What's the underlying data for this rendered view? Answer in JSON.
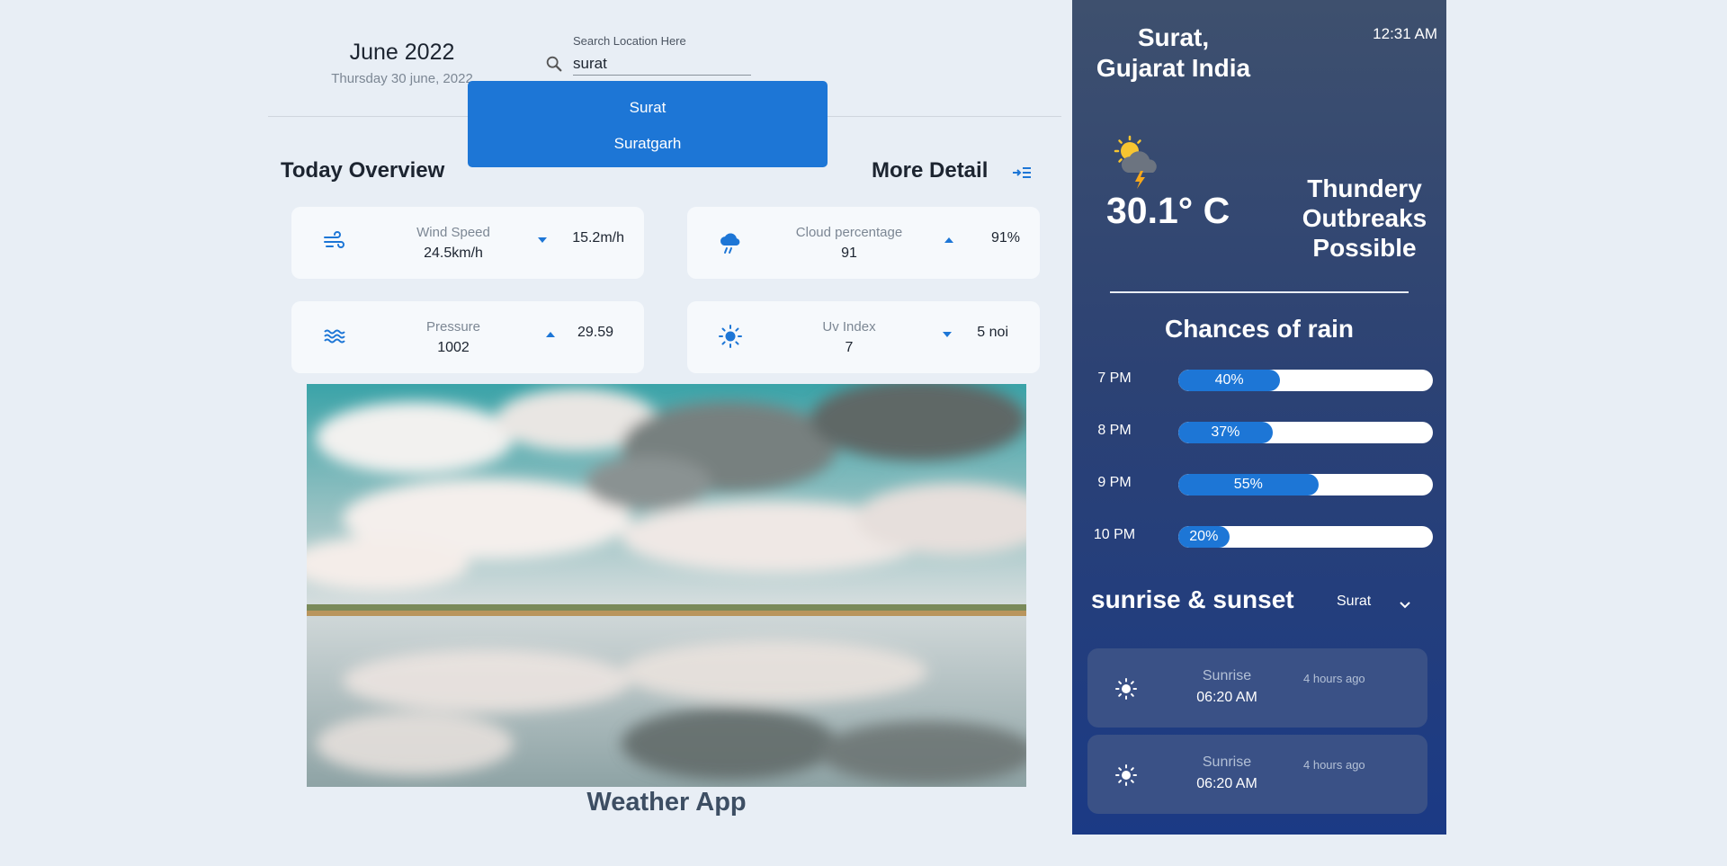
{
  "header": {
    "month": "June 2022",
    "day": "Thursday 30 june, 2022",
    "search_label": "Search Location Here",
    "search_value": "surat"
  },
  "search_results": [
    "Surat",
    "Suratgarh"
  ],
  "overview": {
    "title": "Today Overview",
    "more_detail": "More Detail",
    "cards": [
      {
        "label": "Wind Speed",
        "value": "24.5km/h",
        "trend": "down",
        "change": "15.2m/h",
        "icon": "wind-icon"
      },
      {
        "label": "Cloud percentage",
        "value": "91",
        "trend": "up",
        "change": "91%",
        "icon": "cloud-rain-icon"
      },
      {
        "label": "Pressure",
        "value": "1002",
        "trend": "up",
        "change": "29.59",
        "icon": "waves-icon"
      },
      {
        "label": "Uv Index",
        "value": "7",
        "trend": "down",
        "change": "5 noi",
        "icon": "sun-icon"
      }
    ]
  },
  "app_title": "Weather App",
  "panel": {
    "location": "Surat, Gujarat India",
    "time": "12:31 AM",
    "temperature": "30.1° C",
    "condition": "Thundery Outbreaks Possible",
    "rain_title": "Chances of rain",
    "rain": [
      {
        "time": "7 PM",
        "label": "40%",
        "percent": 40
      },
      {
        "time": "8 PM",
        "label": "37%",
        "percent": 37
      },
      {
        "time": "9 PM",
        "label": "55%",
        "percent": 55
      },
      {
        "time": "10 PM",
        "label": "20%",
        "percent": 20
      }
    ],
    "sun_title": "sunrise & sunset",
    "sun_city": "Surat",
    "sun_cards": [
      {
        "label": "Sunrise",
        "time": "06:20 AM",
        "ago": "4 hours ago"
      },
      {
        "label": "Sunrise",
        "time": "06:20 AM",
        "ago": "4 hours ago"
      }
    ]
  },
  "colors": {
    "accent": "#1d76d6",
    "panel_top": "#3e506e",
    "panel_bottom": "#1b3a85",
    "background": "#e8eef5"
  }
}
